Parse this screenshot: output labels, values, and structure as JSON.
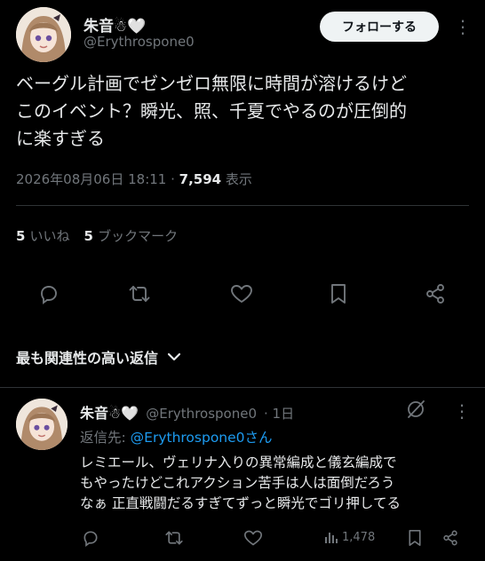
{
  "tweet": {
    "author_name": "朱音☃🤍",
    "author_handle": "@Erythrospone0",
    "follow_label": "フォローする",
    "menu_label": "⋮",
    "text": "ベーグル計画でゼンゼロ無限に時間が溶けるけど\nこのイベント？瞬光、照、千夏でやるのが圧倒的\nに楽すぎる",
    "timestamp": "2026年08月06日 18:11",
    "separator": " · ",
    "views_count": "7,594",
    "views_label": " 表示",
    "likes_count": "5",
    "likes_label": "いいね",
    "bookmarks_count": "5",
    "bookmarks_label": "ブックマーク"
  },
  "actions": [
    "reply-icon",
    "retweet-icon",
    "like-icon",
    "bookmark-icon",
    "share-icon"
  ],
  "replies_section": {
    "label": "最も関連性の高い返信",
    "chevron": "⌄"
  },
  "reply": {
    "author_name": "朱音☃🤍",
    "author_handle": "@Erythrospone0",
    "time": "· 1日",
    "replying_prefix": "返信先: ",
    "replying_to": "@Erythrospone0さん",
    "text": "レミエール、ヴェリナ入りの異常編成と儀玄編成で\nもやったけどこれアクション苦手は人は面倒だろう\nなぁ 正直戦闘だるすぎてずっと瞬光でゴリ押してる",
    "views_count": "1,478"
  },
  "colors": {
    "background": "#000000",
    "text": "#e7e9ea",
    "muted": "#71767b",
    "link": "#1d9bf0",
    "divider": "#2f3336"
  }
}
